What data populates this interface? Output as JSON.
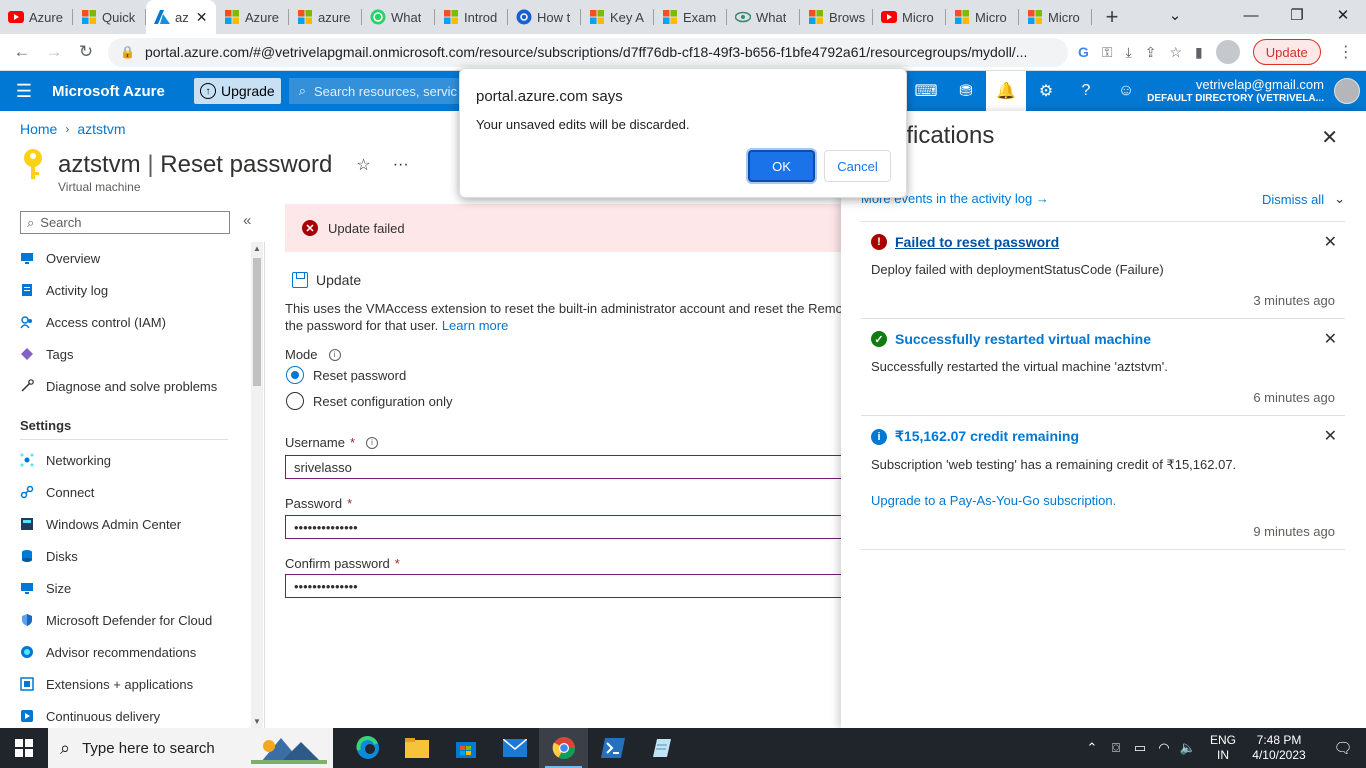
{
  "browser": {
    "tabs": [
      {
        "title": "Azure",
        "icon": "youtube-icon"
      },
      {
        "title": "Quick",
        "icon": "microsoft-icon"
      },
      {
        "title": "az",
        "icon": "azure-icon",
        "active": true
      },
      {
        "title": "Azure",
        "icon": "microsoft-icon"
      },
      {
        "title": "azure",
        "icon": "microsoft-icon"
      },
      {
        "title": "What",
        "icon": "whatsapp-icon"
      },
      {
        "title": "Introd",
        "icon": "microsoft-icon"
      },
      {
        "title": "How t",
        "icon": "link-icon"
      },
      {
        "title": "Key A",
        "icon": "microsoft-icon"
      },
      {
        "title": "Exam",
        "icon": "microsoft-icon"
      },
      {
        "title": "What",
        "icon": "eye-icon"
      },
      {
        "title": "Brows",
        "icon": "microsoft-icon"
      },
      {
        "title": "Micro",
        "icon": "youtube-icon"
      },
      {
        "title": "Micro",
        "icon": "microsoft-icon"
      },
      {
        "title": "Micro",
        "icon": "microsoft-icon"
      }
    ],
    "url": "portal.azure.com/#@vetrivelapgmail.onmicrosoft.com/resource/subscriptions/d7ff76db-cf18-49f3-b656-f1bfe4792a61/resourcegroups/mydoll/...",
    "update_label": "Update"
  },
  "azure": {
    "brand": "Microsoft Azure",
    "upgrade_label": "Upgrade",
    "search_placeholder": "Search resources, servic",
    "account_email": "vetrivelap@gmail.com",
    "account_directory": "DEFAULT DIRECTORY (VETRIVELA..."
  },
  "breadcrumb": {
    "home": "Home",
    "resource": "aztstvm"
  },
  "page": {
    "resource_name": "aztstvm",
    "separator": "|",
    "blade_name": "Reset password",
    "subtitle": "Virtual machine"
  },
  "nav": {
    "search_placeholder": "Search",
    "items": [
      {
        "label": "Overview",
        "icon": "overview-icon"
      },
      {
        "label": "Activity log",
        "icon": "activity-log-icon"
      },
      {
        "label": "Access control (IAM)",
        "icon": "iam-icon"
      },
      {
        "label": "Tags",
        "icon": "tag-icon"
      },
      {
        "label": "Diagnose and solve problems",
        "icon": "wrench-icon"
      }
    ],
    "settings_heading": "Settings",
    "settings_items": [
      {
        "label": "Networking",
        "icon": "networking-icon"
      },
      {
        "label": "Connect",
        "icon": "connect-icon"
      },
      {
        "label": "Windows Admin Center",
        "icon": "admin-center-icon"
      },
      {
        "label": "Disks",
        "icon": "disks-icon"
      },
      {
        "label": "Size",
        "icon": "size-icon"
      },
      {
        "label": "Microsoft Defender for Cloud",
        "icon": "shield-icon"
      },
      {
        "label": "Advisor recommendations",
        "icon": "advisor-icon"
      },
      {
        "label": "Extensions + applications",
        "icon": "extensions-icon"
      },
      {
        "label": "Continuous delivery",
        "icon": "delivery-icon"
      }
    ]
  },
  "main": {
    "error_banner": "Update failed",
    "update_cmd": "Update",
    "description_line1": "This uses the VMAccess extension to reset the built-in administrator account and reset the Remot",
    "description_line2": "the password for that user.",
    "learn_more": "Learn more",
    "mode_label": "Mode",
    "mode_options": [
      "Reset password",
      "Reset configuration only"
    ],
    "mode_selected": 0,
    "username_label": "Username",
    "username_value": "srivelasso",
    "password_label": "Password",
    "password_value": "••••••••••••••",
    "confirm_label": "Confirm password",
    "confirm_value": "••••••••••••••",
    "required_mark": "*"
  },
  "notifications": {
    "title": "ifications",
    "activity_link": "More events in the activity log →",
    "dismiss_all": "Dismiss all",
    "items": [
      {
        "status": "error",
        "title": "Failed to reset password",
        "body": "Deploy failed with deploymentStatusCode (Failure)",
        "time": "3 minutes ago"
      },
      {
        "status": "success",
        "title": "Successfully restarted virtual machine",
        "body": "Successfully restarted the virtual machine 'aztstvm'.",
        "time": "6 minutes ago"
      },
      {
        "status": "info",
        "title": "₹15,162.07 credit remaining",
        "body": "Subscription 'web testing' has a remaining credit of ₹15,162.07.",
        "link": "Upgrade to a Pay-As-You-Go subscription.",
        "time": "9 minutes ago"
      }
    ]
  },
  "dialog": {
    "title": "portal.azure.com says",
    "message": "Your unsaved edits will be discarded.",
    "ok": "OK",
    "cancel": "Cancel"
  },
  "taskbar": {
    "search_placeholder": "Type here to search",
    "lang_line1": "ENG",
    "lang_line2": "IN",
    "time": "7:48 PM",
    "date": "4/10/2023"
  },
  "colors": {
    "azure_blue": "#0078d4",
    "error_red": "#a80000",
    "success_green": "#107c10",
    "info_blue": "#0078d4"
  }
}
